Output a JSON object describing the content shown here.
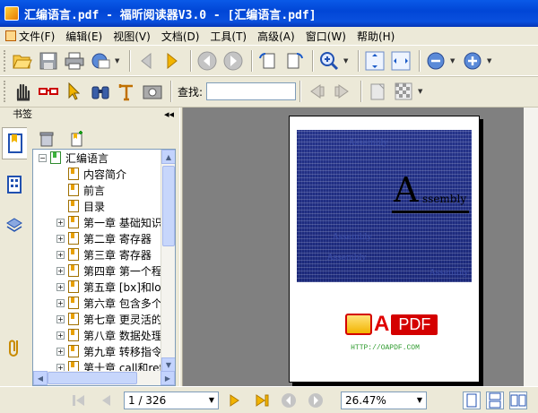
{
  "window": {
    "title": "汇编语言.pdf - 福昕阅读器V3.0 - [汇编语言.pdf]"
  },
  "menu": [
    "文件(F)",
    "编辑(E)",
    "视图(V)",
    "文档(D)",
    "工具(T)",
    "高级(A)",
    "窗口(W)",
    "帮助(H)"
  ],
  "find": {
    "label": "查找:",
    "value": ""
  },
  "bookmarks": {
    "header": "书签",
    "collapse_glyph": "◂◂",
    "root": "汇编语言",
    "items": [
      {
        "label": "内容简介",
        "expandable": false
      },
      {
        "label": "前言",
        "expandable": false
      },
      {
        "label": "目录",
        "expandable": false
      },
      {
        "label": "第一章 基础知识",
        "expandable": true
      },
      {
        "label": "第二章 寄存器",
        "expandable": true
      },
      {
        "label": "第三章 寄存器",
        "expandable": true
      },
      {
        "label": "第四章 第一个程",
        "expandable": true
      },
      {
        "label": "第五章 [bx]和loop",
        "expandable": true
      },
      {
        "label": "第六章 包含多个",
        "expandable": true
      },
      {
        "label": "第七章 更灵活的",
        "expandable": true
      },
      {
        "label": "第八章 数据处理",
        "expandable": true
      },
      {
        "label": "第九章 转移指令",
        "expandable": true
      },
      {
        "label": "第十章 call和ret",
        "expandable": true
      }
    ]
  },
  "cover": {
    "big_letter": "A",
    "word": "ssembly",
    "small_words": [
      "Assembly",
      "Assembly",
      "Assembly",
      "Assembly"
    ],
    "logo_a": "A",
    "logo_pdf": "PDF",
    "url": "HTTP://OAPDF.COM"
  },
  "status": {
    "page": "1 / 326",
    "zoom": "26.47%"
  },
  "colors": {
    "title_bar": "#0a5ae8",
    "cover_blue": "#5a6bb5",
    "logo_red": "#d40000"
  }
}
